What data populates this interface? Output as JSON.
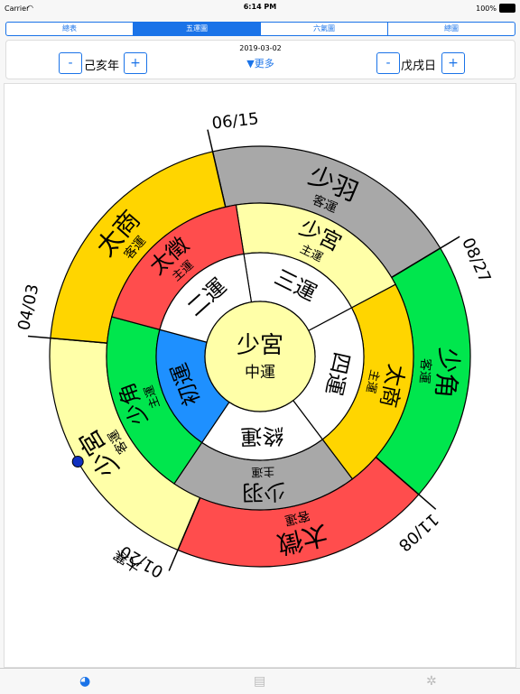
{
  "status": {
    "carrier": "Carrier",
    "time": "6:14 PM",
    "battery": "100%"
  },
  "tabs": [
    "總表",
    "五運圖",
    "六氣圖",
    "總圖"
  ],
  "active_tab": 1,
  "controls": {
    "minus": "-",
    "plus": "+",
    "year": "己亥年",
    "day": "戊戌日",
    "date": "2019-03-02",
    "more": "▼更多"
  },
  "wheel": {
    "center": {
      "title": "少宮",
      "sub": "中運"
    },
    "colors": {
      "yellow": "#ffd500",
      "red": "#ff4d4d",
      "gray": "#a8a8a8",
      "green": "#00e64d",
      "pale": "#ffffa8",
      "blue": "#1e90ff",
      "white": "#ffffff"
    },
    "dates": [
      "06/15",
      "08/27",
      "11/08",
      "01/20",
      "04/03"
    ],
    "small_note": "大寒",
    "outer": [
      {
        "big": "少羽",
        "sub": "客運",
        "color": "gray"
      },
      {
        "big": "少角",
        "sub": "客運",
        "color": "green"
      },
      {
        "big": "太徵",
        "sub": "客運",
        "color": "red"
      },
      {
        "big": "少宮",
        "sub": "客運",
        "color": "pale"
      },
      {
        "big": "太商",
        "sub": "客運",
        "color": "yellow"
      }
    ],
    "middle": [
      {
        "big": "少宮",
        "sub": "主運",
        "color": "pale"
      },
      {
        "big": "太商",
        "sub": "主運",
        "color": "yellow"
      },
      {
        "big": "少羽",
        "sub": "主運",
        "color": "gray"
      },
      {
        "big": "少角",
        "sub": "主運",
        "color": "green"
      },
      {
        "big": "太徵",
        "sub": "主運",
        "color": "red"
      }
    ],
    "inner": [
      {
        "label": "三運",
        "color": "white"
      },
      {
        "label": "四運",
        "color": "white"
      },
      {
        "label": "終運",
        "color": "white"
      },
      {
        "label": "初運",
        "color": "blue"
      },
      {
        "label": "二運",
        "color": "white"
      }
    ]
  }
}
